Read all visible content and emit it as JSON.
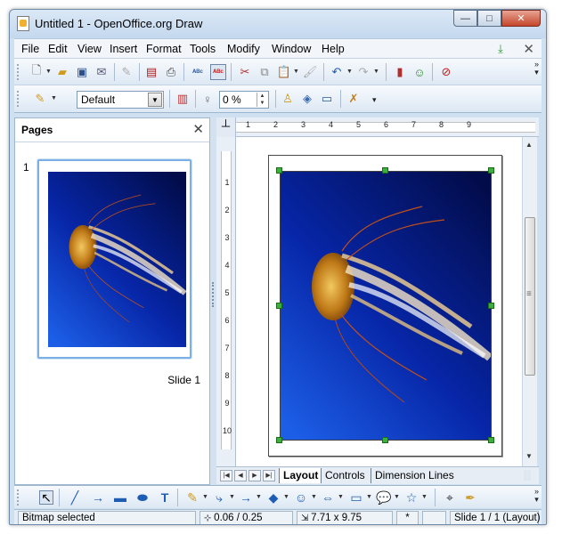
{
  "window": {
    "title": "Untitled 1 - OpenOffice.org Draw",
    "minimize_glyph": "—",
    "maximize_glyph": "□",
    "close_glyph": "✕"
  },
  "menu": [
    "File",
    "Edit",
    "View",
    "Insert",
    "Format",
    "Tools",
    "Modify",
    "Window",
    "Help"
  ],
  "menu_close": "✕",
  "toolbar2": {
    "style_value": "Default",
    "transparency_value": "0 %"
  },
  "pages_panel": {
    "title": "Pages",
    "close": "✕",
    "page_number": "1",
    "slide_label": "Slide 1"
  },
  "ruler": {
    "h_ticks": [
      "1",
      "2",
      "3",
      "4",
      "5",
      "6",
      "7",
      "8",
      "9"
    ],
    "v_ticks": [
      "1",
      "2",
      "3",
      "4",
      "5",
      "6",
      "7",
      "8",
      "9",
      "10"
    ]
  },
  "tabs": [
    "Layout",
    "Controls",
    "Dimension Lines"
  ],
  "status": {
    "selection": "Bitmap selected",
    "position": "0.06 / 0.25",
    "size": "7.71 x 9.75",
    "modified": "*",
    "slide": "Slide 1 / 1 (Layout)"
  },
  "icons": {
    "new": "new-document-icon",
    "open": "open-folder-icon",
    "save": "save-icon",
    "spellcheck": "spellcheck-icon",
    "cut": "cut-icon",
    "undo": "undo-icon",
    "chart": "chart-icon",
    "gallery": "gallery-icon",
    "navigator": "navigator-icon"
  },
  "colors": {
    "accent": "#1d5db3",
    "selection_handle": "#3cb03c",
    "jelly_bg_top": "#041878",
    "jelly_bg_bottom": "#1a52d8"
  }
}
